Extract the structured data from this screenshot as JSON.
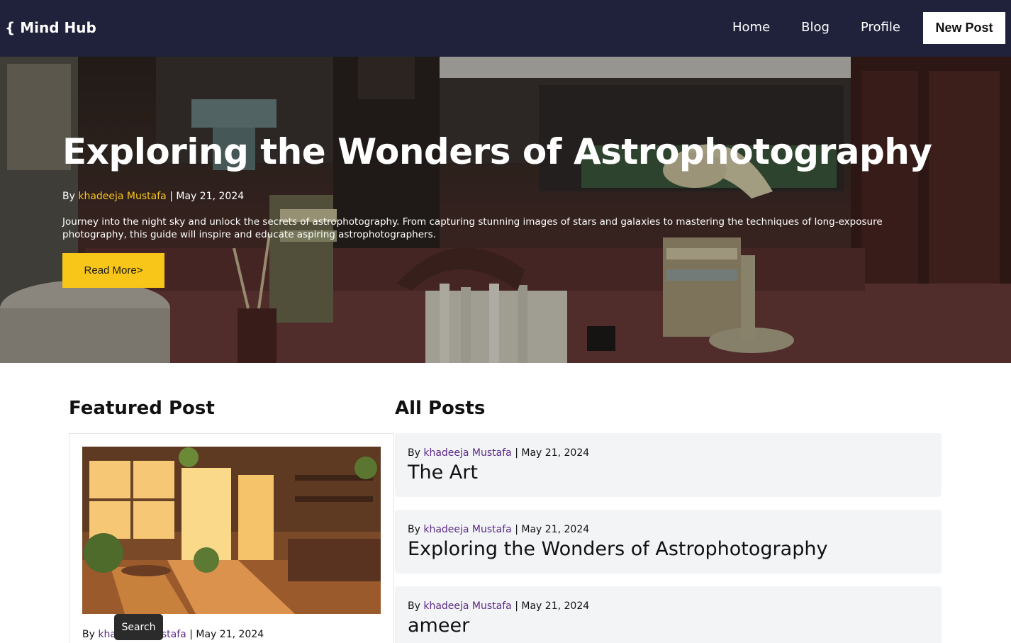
{
  "navbar": {
    "logo": "{ Mind Hub",
    "links": [
      "Home",
      "Blog",
      "Profile"
    ],
    "new_post_label": "New Post"
  },
  "hero": {
    "title": "Exploring the Wonders of Astrophotography",
    "by_label": "By",
    "author": "khadeeja Mustafa",
    "separator": "|",
    "date": "May 21, 2024",
    "excerpt": "Journey into the night sky and unlock the secrets of astrophotography. From capturing stunning images of stars and galaxies to mastering the techniques of long-exposure photography, this guide will inspire and educate aspiring astrophotographers.",
    "read_more_label": "Read More>"
  },
  "featured": {
    "heading": "Featured Post",
    "by_label": "By",
    "author": "khadeeja Mustafa",
    "separator": "|",
    "date": "May 21, 2024"
  },
  "all_posts": {
    "heading": "All Posts",
    "items": [
      {
        "by_label": "By",
        "author": "khadeeja Mustafa",
        "separator": "|",
        "date": "May 21, 2024",
        "title": "The Art"
      },
      {
        "by_label": "By",
        "author": "khadeeja Mustafa",
        "separator": "|",
        "date": "May 21, 2024",
        "title": "Exploring the Wonders of Astrophotography"
      },
      {
        "by_label": "By",
        "author": "khadeeja Mustafa",
        "separator": "|",
        "date": "May 21, 2024",
        "title": "ameer"
      }
    ]
  },
  "tooltip": {
    "text": "Search"
  },
  "colors": {
    "navbar_bg": "#20213a",
    "accent_yellow": "#f8c619",
    "author_purple": "#5b2a86",
    "post_bg": "#f3f4f6"
  }
}
